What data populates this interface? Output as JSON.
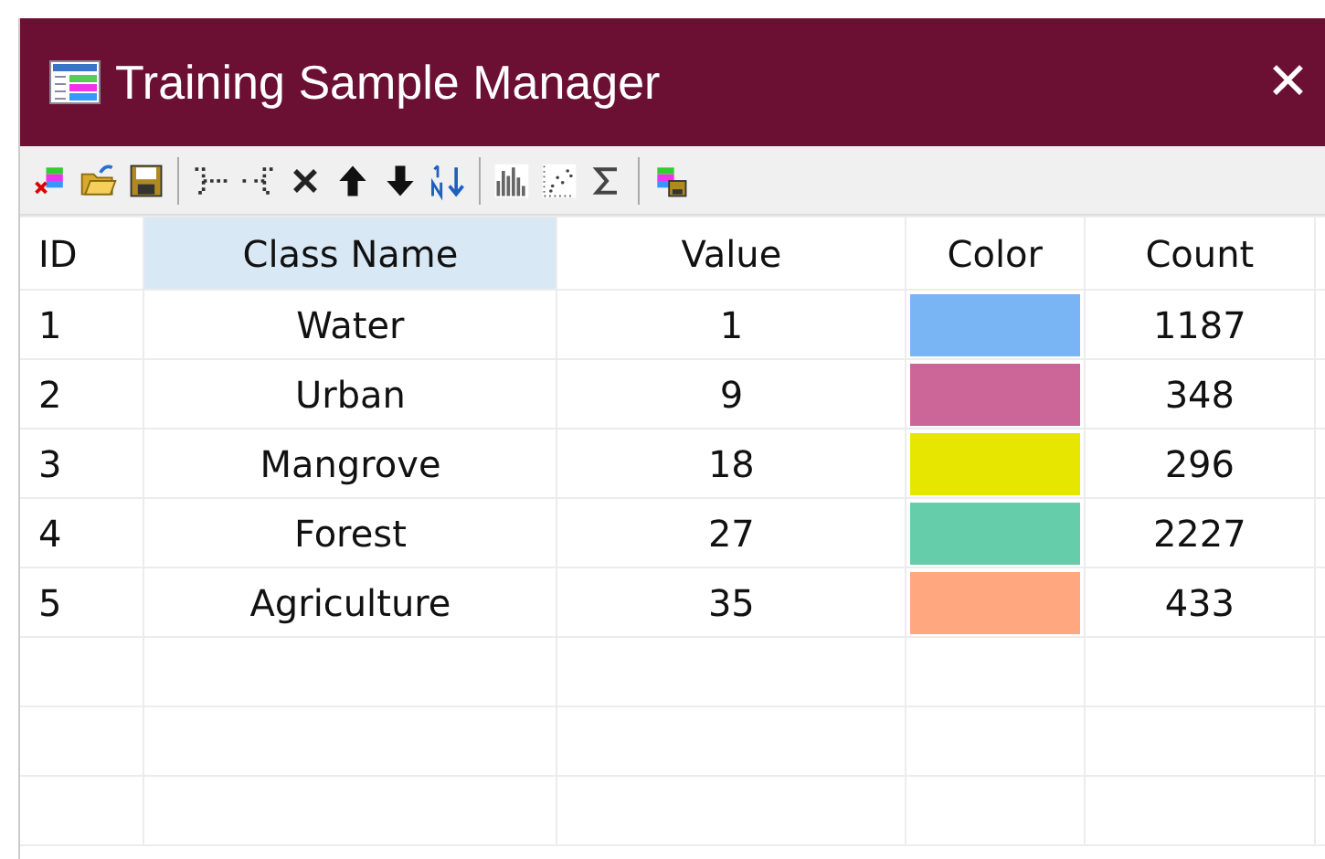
{
  "window": {
    "title": "Training Sample Manager",
    "close": "✕"
  },
  "table": {
    "columns": [
      {
        "label": "ID",
        "selected": false
      },
      {
        "label": "Class Name",
        "selected": true
      },
      {
        "label": "Value",
        "selected": false
      },
      {
        "label": "Color",
        "selected": false
      },
      {
        "label": "Count",
        "selected": false
      }
    ],
    "rows": [
      {
        "id": "1",
        "class_name": "Water",
        "value": "1",
        "color": "#79b4f5",
        "count": "1187"
      },
      {
        "id": "2",
        "class_name": "Urban",
        "value": "9",
        "color": "#cc6699",
        "count": "348"
      },
      {
        "id": "3",
        "class_name": "Mangrove",
        "value": "18",
        "color": "#e6e600",
        "count": "296"
      },
      {
        "id": "4",
        "class_name": "Forest",
        "value": "27",
        "color": "#66cdaa",
        "count": "2227"
      },
      {
        "id": "5",
        "class_name": "Agriculture",
        "value": "35",
        "color": "#ffa77f",
        "count": "433"
      }
    ]
  }
}
